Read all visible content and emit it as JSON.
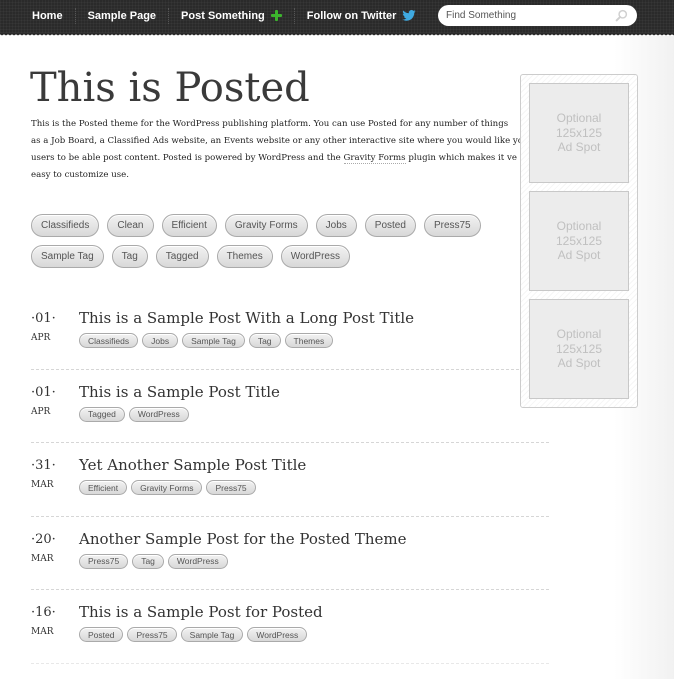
{
  "nav": {
    "items": [
      {
        "label": "Home"
      },
      {
        "label": "Sample Page"
      },
      {
        "label": "Post Something",
        "icon": "plus-icon"
      },
      {
        "label": "Follow on Twitter",
        "icon": "twitter-bird-icon"
      }
    ],
    "search_placeholder": "Find Something"
  },
  "header": {
    "title": "This is Posted",
    "intro_lines": [
      "This is the Posted theme for the WordPress publishing platform. You can use Posted for any number of things",
      "as a Job Board, a Classified Ads website, an Events website or any other interactive site where you would like yo",
      "users to be able post content. Posted is powered by WordPress and the ",
      "easy to customize use."
    ],
    "intro_link": "Gravity Forms",
    "intro_line3_tail": " plugin which makes it ve"
  },
  "tagcloud": [
    "Classifieds",
    "Clean",
    "Efficient",
    "Gravity Forms",
    "Jobs",
    "Posted",
    "Press75",
    "Sample Tag",
    "Tag",
    "Tagged",
    "Themes",
    "WordPress"
  ],
  "posts": [
    {
      "day": "·01·",
      "month": "APR",
      "title": "This is a Sample Post With a Long Post Title",
      "tags": [
        "Classifieds",
        "Jobs",
        "Sample Tag",
        "Tag",
        "Themes"
      ]
    },
    {
      "day": "·01·",
      "month": "APR",
      "title": "This is a Sample Post Title",
      "tags": [
        "Tagged",
        "WordPress"
      ]
    },
    {
      "day": "·31·",
      "month": "MAR",
      "title": "Yet Another Sample Post Title",
      "tags": [
        "Efficient",
        "Gravity Forms",
        "Press75"
      ]
    },
    {
      "day": "·20·",
      "month": "MAR",
      "title": "Another Sample Post for the Posted Theme",
      "tags": [
        "Press75",
        "Tag",
        "WordPress"
      ]
    },
    {
      "day": "·16·",
      "month": "MAR",
      "title": "This is a Sample Post for Posted",
      "tags": [
        "Posted",
        "Press75",
        "Sample Tag",
        "WordPress"
      ]
    }
  ],
  "ads": [
    {
      "line1": "Optional",
      "line2": "125x125",
      "line3": "Ad Spot"
    },
    {
      "line1": "Optional",
      "line2": "125x125",
      "line3": "Ad Spot"
    },
    {
      "line1": "Optional",
      "line2": "125x125",
      "line3": "Ad Spot"
    }
  ],
  "colors": {
    "topbar": "#2a2a2a",
    "plus": "#3cb52d",
    "twitter": "#3fa9e0"
  }
}
